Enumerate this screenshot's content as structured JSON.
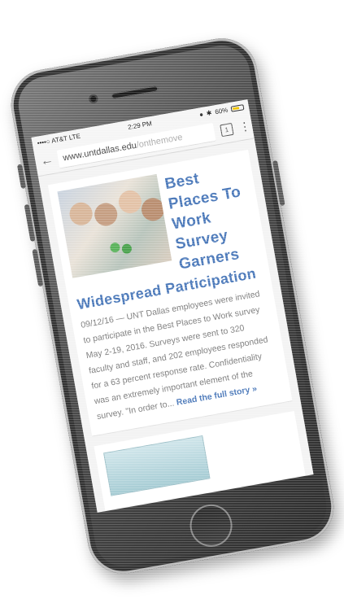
{
  "status_bar": {
    "carrier": "••••○ AT&T  LTE",
    "time": "2:29 PM",
    "battery": "60%"
  },
  "browser": {
    "url_main": "www.untdallas.edu",
    "url_faded": "/onthemove",
    "tab_count": "1"
  },
  "article": {
    "title_lines": [
      "Best",
      "Places To",
      "Work",
      "Survey",
      "Garners"
    ],
    "title_rest": "Widespread Participation",
    "excerpt": "09/12/16 — UNT Dallas employees were invited to participate in the Best Places to Work survey May 2-19, 2016. Surveys were sent to 320 faculty and staff, and 202 employees responded for a 63 percent response rate.  Confidentiality was an extremely important element of the survey.  \"In order to... ",
    "read_more": "Read the full story »"
  },
  "colors": {
    "accent": "#4a78b9",
    "body_text": "#7a7a7a",
    "phone_body": "#4a4a4a"
  },
  "icons": {
    "back": "back-arrow-icon",
    "tabs": "tabs-icon",
    "menu": "overflow-menu-icon",
    "battery": "battery-icon",
    "lock": "lock-icon",
    "bluetooth": "bluetooth-icon"
  }
}
